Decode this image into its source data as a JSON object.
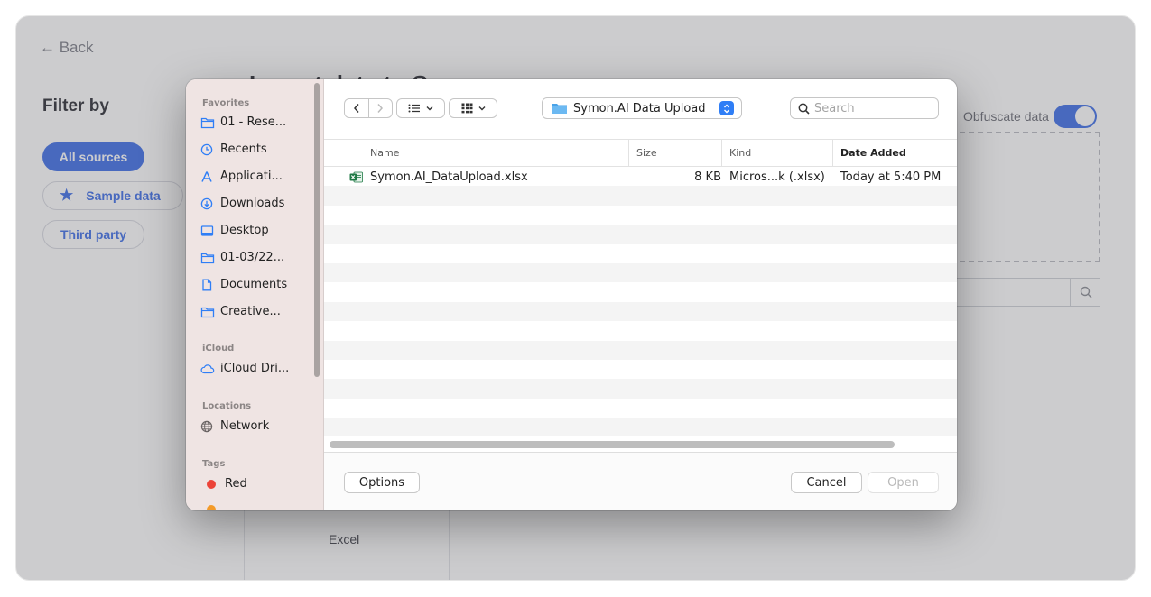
{
  "background": {
    "back_label": "← Back",
    "page_title": "Import data to Symon",
    "filter_title": "Filter by",
    "chips": [
      "All sources",
      "Sample data",
      "Third party"
    ],
    "obfuscate_label": "Obfuscate data",
    "obfuscate_on": true,
    "source_card_label": "Excel"
  },
  "dialog": {
    "sidebar": {
      "sections": {
        "favorites": "Favorites",
        "icloud": "iCloud",
        "locations": "Locations",
        "tags": "Tags"
      },
      "favorites": [
        {
          "label": "01 - Rese...",
          "icon": "folder-icon"
        },
        {
          "label": "Recents",
          "icon": "clock-icon"
        },
        {
          "label": "Applicati...",
          "icon": "applications-icon"
        },
        {
          "label": "Downloads",
          "icon": "download-icon"
        },
        {
          "label": "Desktop",
          "icon": "desktop-icon"
        },
        {
          "label": "01-03/22...",
          "icon": "folder-icon"
        },
        {
          "label": "Documents",
          "icon": "document-icon"
        },
        {
          "label": "Creative...",
          "icon": "folder-icon"
        }
      ],
      "icloud": [
        {
          "label": "iCloud Dri...",
          "icon": "cloud-icon"
        }
      ],
      "locations": [
        {
          "label": "Network",
          "icon": "globe-icon"
        }
      ],
      "tags": [
        {
          "label": "Red",
          "color": "#ec4338"
        }
      ]
    },
    "toolbar": {
      "location": "Symon.AI Data Upload",
      "search_placeholder": "Search"
    },
    "columns": {
      "name": "Name",
      "size": "Size",
      "kind": "Kind",
      "date_added": "Date Added"
    },
    "files": [
      {
        "name": "Symon.AI_DataUpload.xlsx",
        "size": "8 KB",
        "kind": "Micros...k (.xlsx)",
        "date_added": "Today at 5:40 PM"
      }
    ],
    "buttons": {
      "options": "Options",
      "cancel": "Cancel",
      "open": "Open"
    }
  }
}
